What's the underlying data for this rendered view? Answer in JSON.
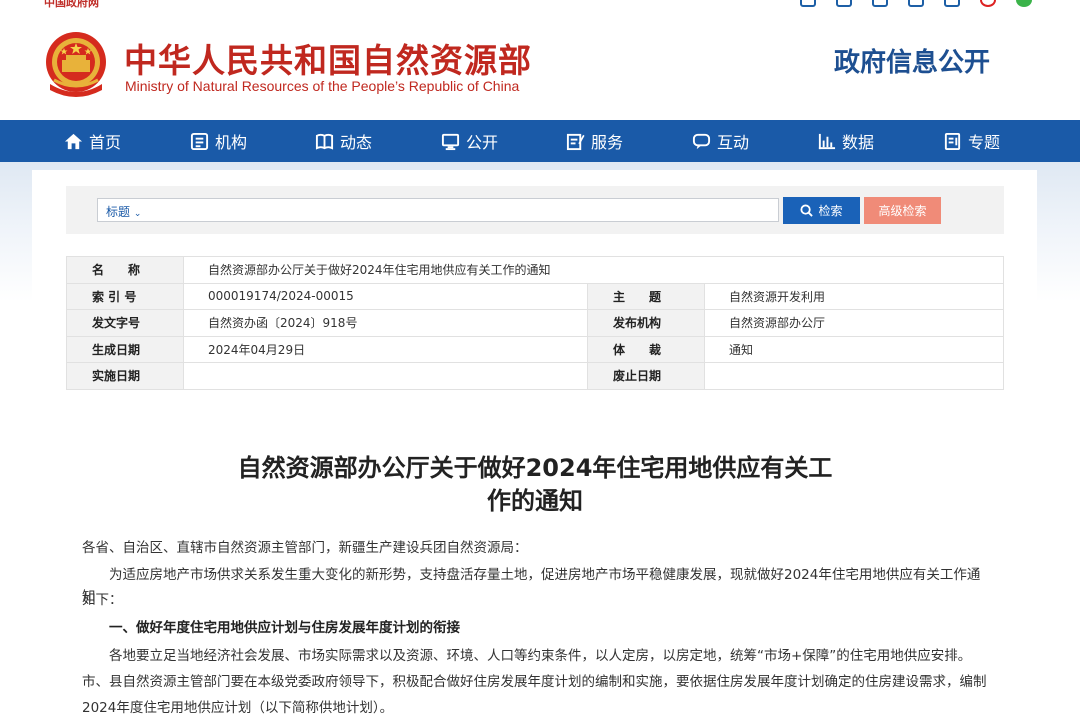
{
  "topbar": {
    "gov_link": "中国政府网"
  },
  "header": {
    "title": "中华人民共和国自然资源部",
    "subtitle": "Ministry of Natural Resources of the People’s Republic of China",
    "section": "政府信息公开"
  },
  "nav": {
    "items": [
      {
        "label": "首页",
        "icon": "home-icon"
      },
      {
        "label": "机构",
        "icon": "org-icon"
      },
      {
        "label": "动态",
        "icon": "book-icon"
      },
      {
        "label": "公开",
        "icon": "monitor-icon"
      },
      {
        "label": "服务",
        "icon": "edit-icon"
      },
      {
        "label": "互动",
        "icon": "chat-icon"
      },
      {
        "label": "数据",
        "icon": "chart-icon"
      },
      {
        "label": "专题",
        "icon": "file-icon"
      }
    ]
  },
  "search": {
    "scope": "标题",
    "button": "检索",
    "advanced": "高级检索"
  },
  "meta": {
    "name_label": "名　　称",
    "name_value": "自然资源部办公厅关于做好2024年住宅用地供应有关工作的通知",
    "index_label": "索 引 号",
    "index_value": "000019174/2024-00015",
    "topic_label": "主　　题",
    "topic_value": "自然资源开发利用",
    "doc_no_label": "发文字号",
    "doc_no_value": "自然资办函〔2024〕918号",
    "issuer_label": "发布机构",
    "issuer_value": "自然资源部办公厅",
    "date_label": "生成日期",
    "date_value": "2024年04月29日",
    "genre_label": "体　　裁",
    "genre_value": "通知",
    "effective_label": "实施日期",
    "effective_value": "",
    "expiry_label": "废止日期",
    "expiry_value": ""
  },
  "article": {
    "title_line1": "自然资源部办公厅关于做好2024年住宅用地供应有关工",
    "title_line2": "作的通知",
    "salutation": "各省、自治区、直辖市自然资源主管部门，新疆生产建设兵团自然资源局：",
    "p1_line1": "为适应房地产市场供求关系发生重大变化的新形势，支持盘活存量土地，促进房地产市场平稳健康发展，现就做好2024年住宅用地供应有关工作通知",
    "p1_line2": "如下：",
    "h1": "一、做好年度住宅用地供应计划与住房发展年度计划的衔接",
    "p2_line1": "各地要立足当地经济社会发展、市场实际需求以及资源、环境、人口等约束条件，以人定房，以房定地，统筹“市场+保障”的住宅用地供应安排。",
    "p2_line2": "市、县自然资源主管部门要在本级党委政府领导下，积极配合做好住房发展年度计划的编制和实施，要依据住房发展年度计划确定的住房建设需求，编制",
    "p2_line3": "2024年度住宅用地供应计划（以下简称供地计划）。"
  }
}
